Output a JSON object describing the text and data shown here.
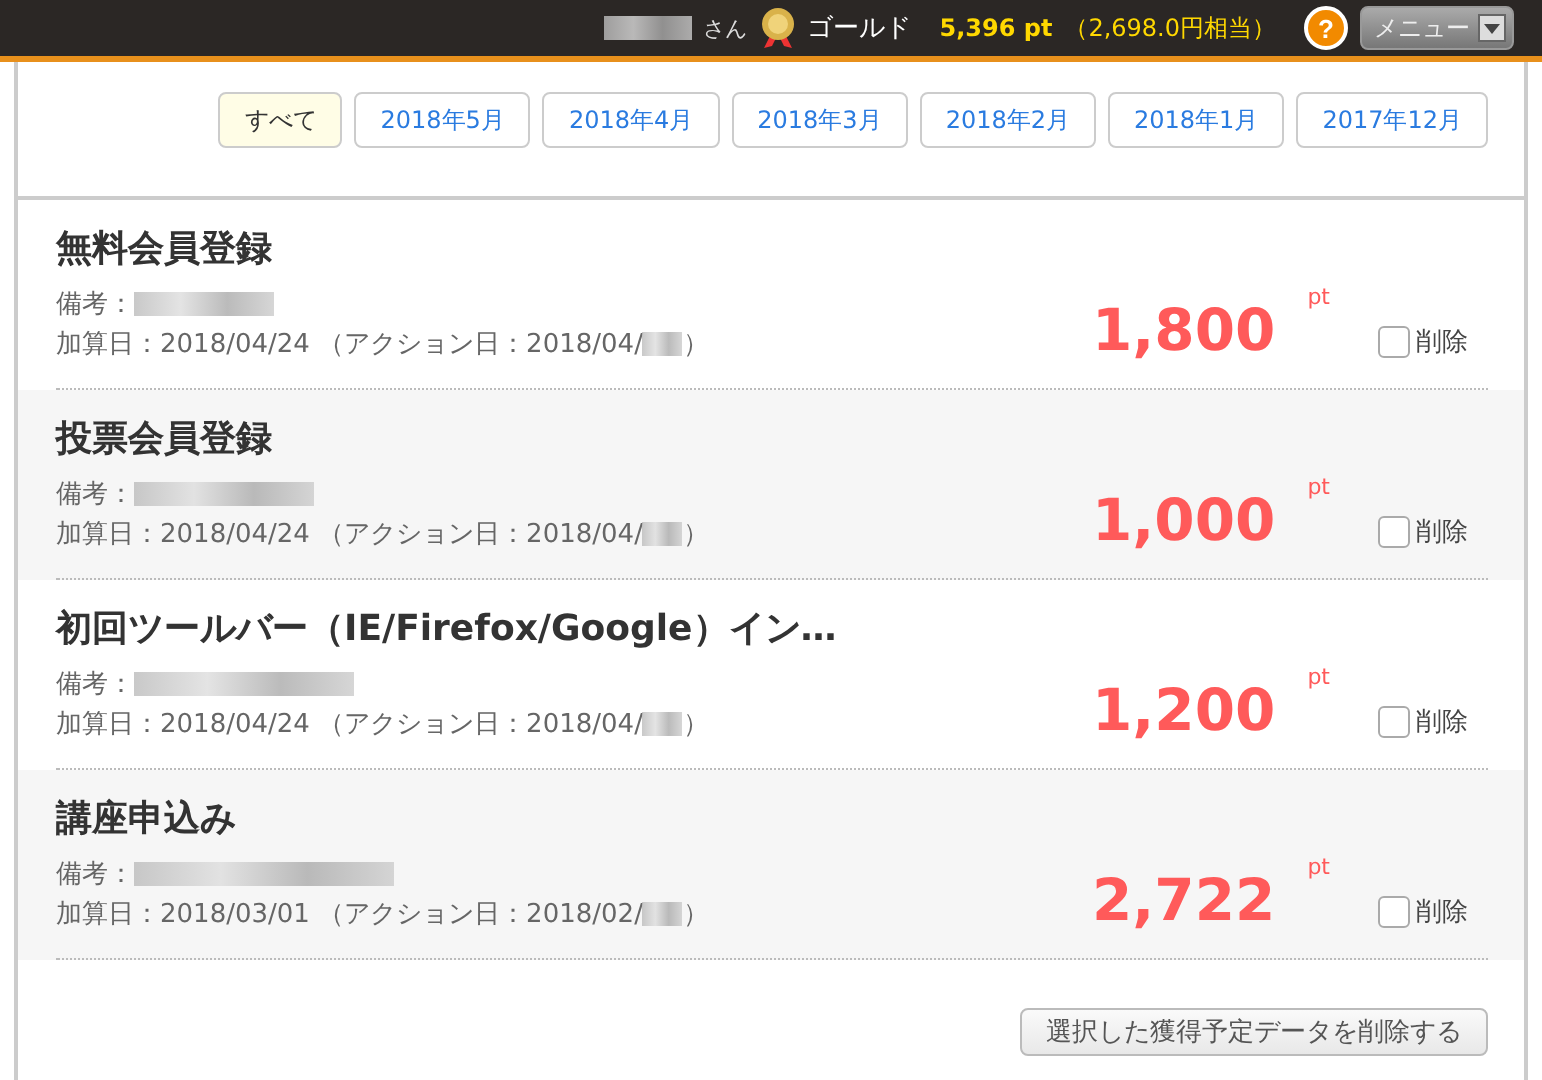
{
  "header": {
    "honorific": "さん",
    "rank": "ゴールド",
    "points": "5,396 pt",
    "value": "（2,698.0円相当）",
    "help": "?",
    "menu": "メニュー"
  },
  "tabs": [
    {
      "label": "すべて",
      "selected": true
    },
    {
      "label": "2018年5月",
      "selected": false
    },
    {
      "label": "2018年4月",
      "selected": false
    },
    {
      "label": "2018年3月",
      "selected": false
    },
    {
      "label": "2018年2月",
      "selected": false
    },
    {
      "label": "2018年1月",
      "selected": false
    },
    {
      "label": "2017年12月",
      "selected": false
    }
  ],
  "entries": [
    {
      "title": "無料会員登録",
      "note_label": "備考：",
      "date": "加算日：2018/04/24 （アクション日：2018/04/",
      "date_end": "）",
      "points": "1,800",
      "unit": "pt",
      "delete_label": "削除",
      "checked": false
    },
    {
      "title": "投票会員登録",
      "note_label": "備考：",
      "date": "加算日：2018/04/24 （アクション日：2018/04/",
      "date_end": "）",
      "points": "1,000",
      "unit": "pt",
      "delete_label": "削除",
      "checked": false
    },
    {
      "title": "初回ツールバー（IE/Firefox/Google）イン…",
      "note_label": "備考：",
      "date": "加算日：2018/04/24 （アクション日：2018/04/",
      "date_end": "）",
      "points": "1,200",
      "unit": "pt",
      "delete_label": "削除",
      "checked": false
    },
    {
      "title": "講座申込み",
      "note_label": "備考：",
      "date": "加算日：2018/03/01 （アクション日：2018/02/",
      "date_end": "）",
      "points": "2,722",
      "unit": "pt",
      "delete_label": "削除",
      "checked": false
    }
  ],
  "delete_button": "選択した獲得予定データを削除する"
}
